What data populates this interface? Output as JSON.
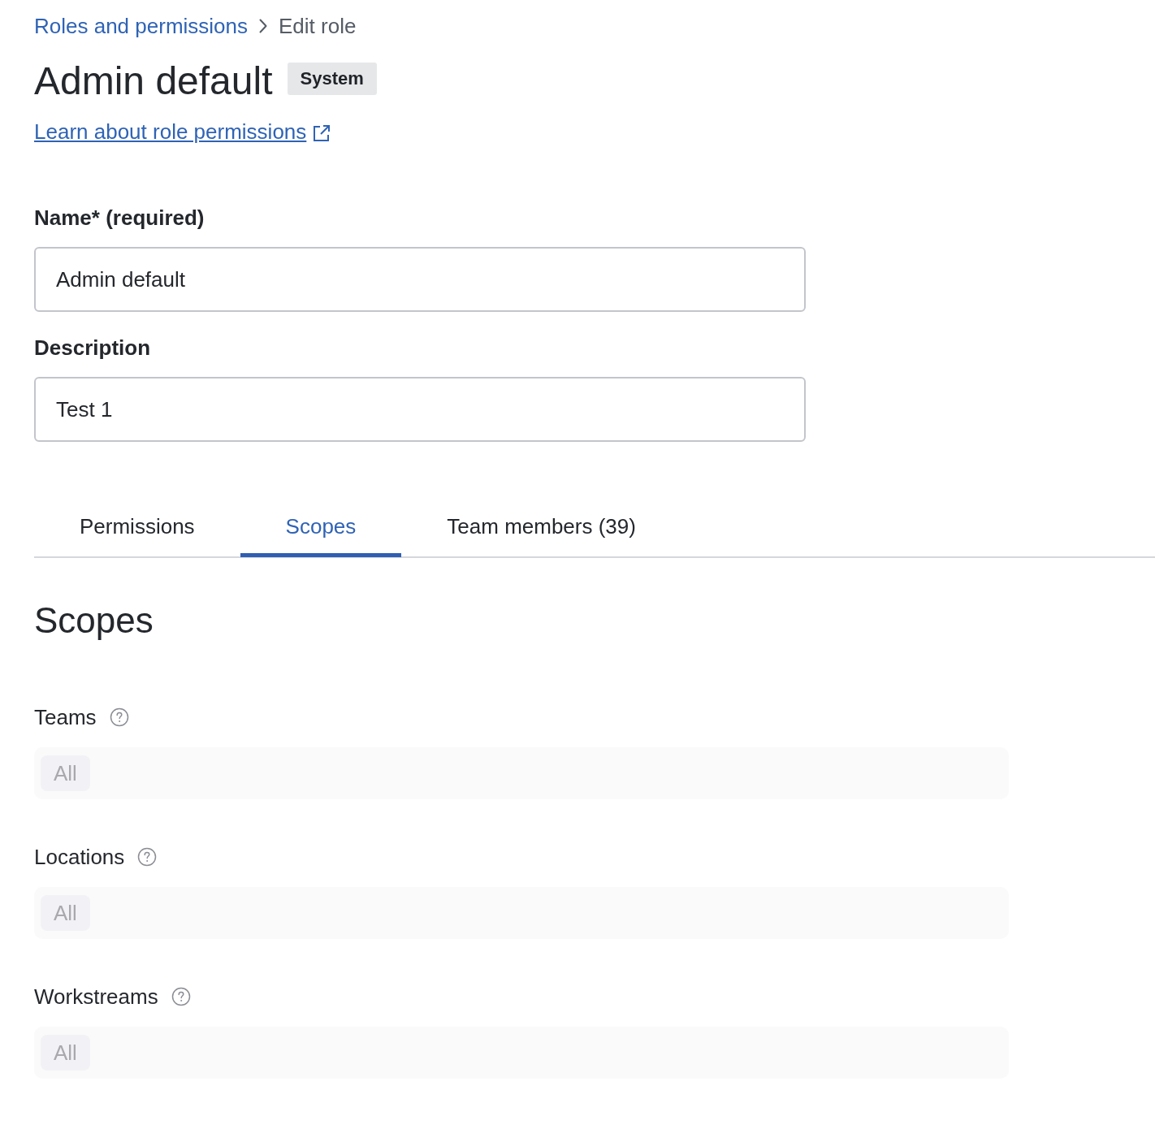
{
  "breadcrumb": [
    {
      "label": "Roles and permissions",
      "kind": "link"
    },
    {
      "label": "Edit role",
      "kind": "current"
    }
  ],
  "header": {
    "title": "Admin default",
    "badge": "System",
    "help_link": "Learn about role permissions"
  },
  "form": {
    "fields": [
      {
        "label": "Name* (required)",
        "value": "Admin default"
      },
      {
        "label": "Description",
        "value": "Test 1"
      }
    ]
  },
  "tabs": [
    {
      "label": "Permissions",
      "selected": false
    },
    {
      "label": "Scopes",
      "selected": true
    },
    {
      "label": "Team members (39)",
      "selected": false
    }
  ],
  "section": {
    "heading": "Scopes",
    "scopes": [
      {
        "label": "Teams",
        "disabled": true,
        "chips": [
          "All"
        ]
      },
      {
        "label": "Locations",
        "disabled": true,
        "chips": [
          "All"
        ]
      },
      {
        "label": "Workstreams",
        "disabled": true,
        "chips": [
          "All"
        ]
      }
    ]
  }
}
